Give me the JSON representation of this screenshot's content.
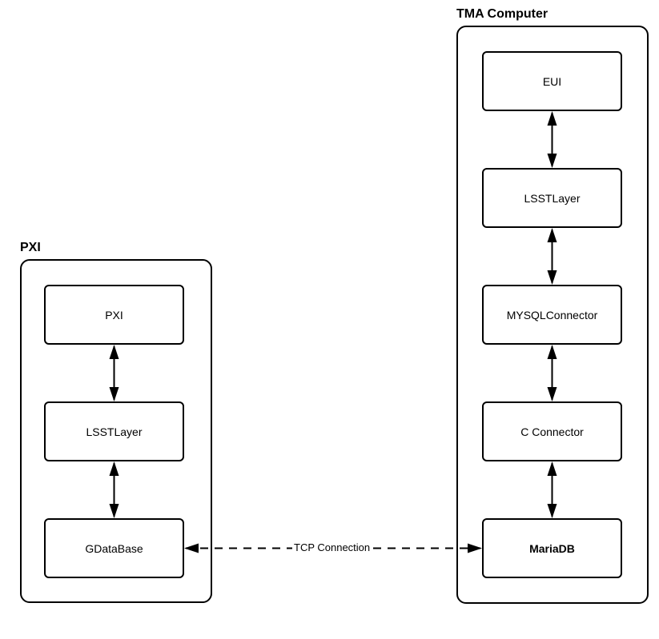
{
  "containers": {
    "pxi": {
      "label": "PXI"
    },
    "tma": {
      "label": "TMA Computer"
    }
  },
  "nodes": {
    "pxi_inner": {
      "label": "PXI"
    },
    "pxi_lsst": {
      "label": "LSSTLayer"
    },
    "pxi_gdb": {
      "label": "GDataBase"
    },
    "tma_eui": {
      "label": "EUI"
    },
    "tma_lsst": {
      "label": "LSSTLayer"
    },
    "tma_mysql": {
      "label": "MYSQLConnector"
    },
    "tma_cconn": {
      "label": "C Connector"
    },
    "tma_mariadb": {
      "label": "MariaDB"
    }
  },
  "edges": {
    "tcp": {
      "label": "TCP Connection"
    }
  }
}
